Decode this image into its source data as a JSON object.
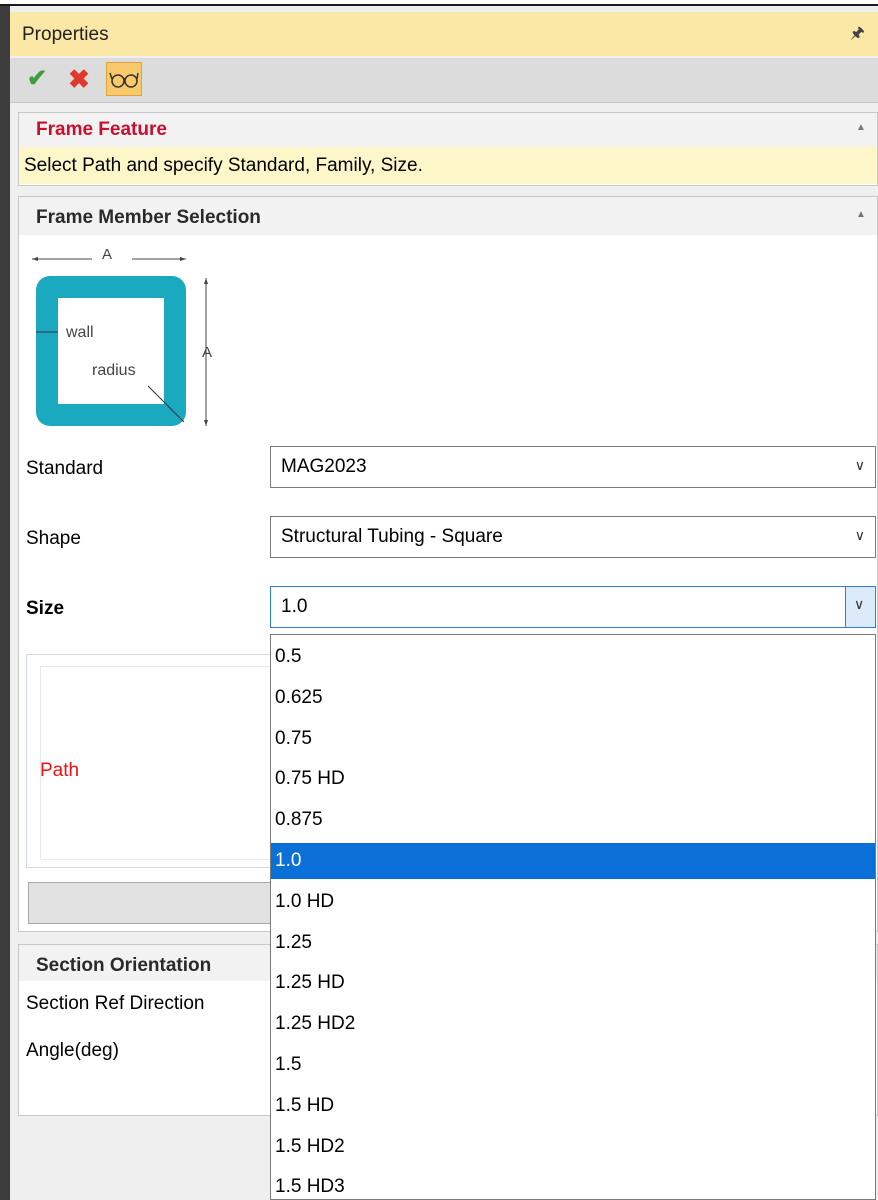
{
  "panel": {
    "title": "Properties",
    "pin_icon": "pin-icon"
  },
  "toolbar": {
    "ok_icon": "checkmark-icon",
    "cancel_icon": "x-icon",
    "preview_icon": "eyeglasses-icon"
  },
  "frame_feature": {
    "title": "Frame Feature",
    "message": "Select Path and specify Standard, Family, Size."
  },
  "frame_member": {
    "title": "Frame Member Selection",
    "diagram": {
      "dim_top": "A",
      "dim_side": "A",
      "wall": "wall",
      "radius": "radius"
    },
    "standard": {
      "label": "Standard",
      "value": "MAG2023"
    },
    "shape": {
      "label": "Shape",
      "value": "Structural Tubing - Square"
    },
    "size": {
      "label": "Size",
      "value": "1.0",
      "options": [
        "0.5",
        "0.625",
        "0.75",
        "0.75 HD",
        "0.875",
        "1.0",
        "1.0 HD",
        "1.25",
        "1.25 HD",
        "1.25 HD2",
        "1.5",
        "1.5 HD",
        "1.5 HD2",
        "1.5 HD3"
      ],
      "selected": "1.0"
    },
    "path_label": "Path"
  },
  "section_orientation": {
    "title": "Section Orientation",
    "ref_direction_label": "Section Ref Direction",
    "angle_label": "Angle(deg)"
  },
  "colors": {
    "title_bar": "#fbe7a6",
    "message_bar": "#fdf6c9",
    "accent_red": "#c8102e",
    "selection": "#0a6fd6",
    "tube": "#1aa9bf"
  }
}
